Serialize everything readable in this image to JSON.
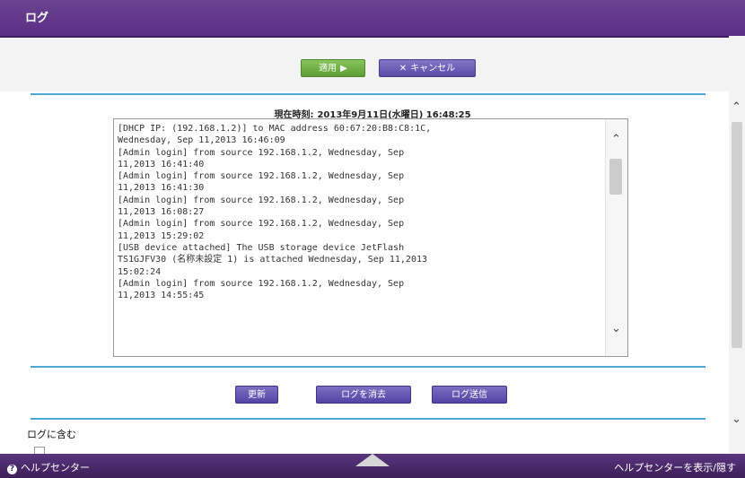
{
  "window": {
    "title": "ログ"
  },
  "actions": {
    "apply_label": "適用",
    "cancel_label": "キャンセル"
  },
  "log": {
    "timestamp_label": "現在時刻:",
    "timestamp_value": "2013年9月11日(水曜日) 16:48:25",
    "text": "[DHCP IP: (192.168.1.2)] to MAC address 60:67:20:B8:C8:1C,\nWednesday, Sep 11,2013 16:46:09\n[Admin login] from source 192.168.1.2, Wednesday, Sep\n11,2013 16:41:40\n[Admin login] from source 192.168.1.2, Wednesday, Sep\n11,2013 16:41:30\n[Admin login] from source 192.168.1.2, Wednesday, Sep\n11,2013 16:08:27\n[Admin login] from source 192.168.1.2, Wednesday, Sep\n11,2013 15:29:02\n[USB device attached] The USB storage device JetFlash\nTS1GJFV30 (名称未設定 1) is attached Wednesday, Sep 11,2013\n15:02:24\n[Admin login] from source 192.168.1.2, Wednesday, Sep\n11,2013 14:55:45"
  },
  "buttons": {
    "refresh": "更新",
    "clear": "ログを消去",
    "send": "ログ送信"
  },
  "section": {
    "include_label": "ログに含む"
  },
  "footer": {
    "help_label": "ヘルプセンター",
    "show_label": "ヘルプセンターを表示/隠す"
  },
  "colors": {
    "accent_purple": "#5a2e86",
    "rule_blue": "#4aa7d8",
    "apply_green": "#5d9d34"
  }
}
